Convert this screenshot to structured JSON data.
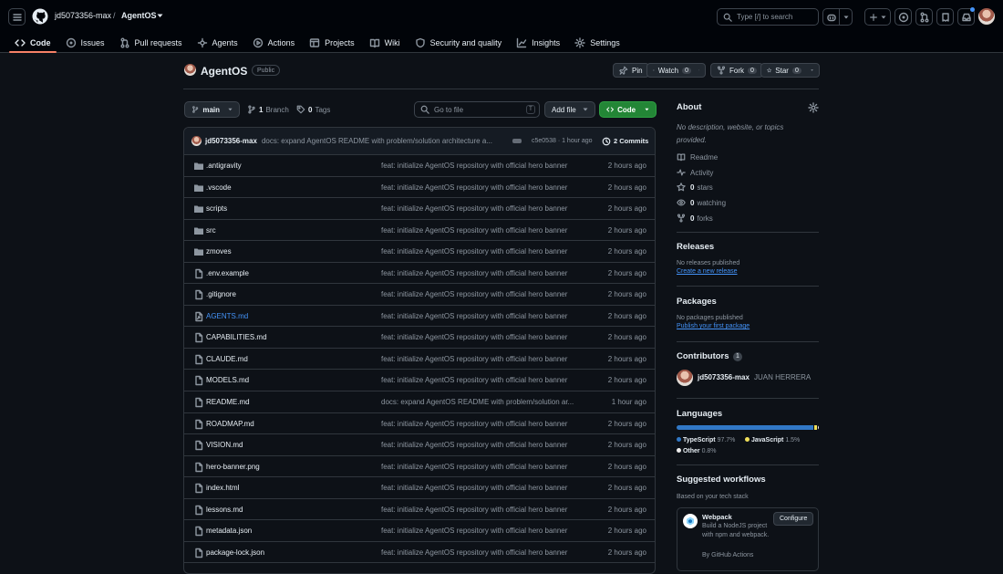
{
  "header": {
    "owner": "jd5073356-max",
    "separator": "/",
    "repo": "AgentOS",
    "search_text": "Type [/] to search"
  },
  "nav": {
    "tabs": [
      {
        "label": "Code",
        "icon": "code-icon",
        "active": true
      },
      {
        "label": "Issues",
        "icon": "issue-icon"
      },
      {
        "label": "Pull requests",
        "icon": "pull-request-icon"
      },
      {
        "label": "Agents",
        "icon": "agents-icon"
      },
      {
        "label": "Actions",
        "icon": "play-icon"
      },
      {
        "label": "Projects",
        "icon": "table-icon"
      },
      {
        "label": "Wiki",
        "icon": "book-icon"
      },
      {
        "label": "Security and quality",
        "icon": "shield-icon"
      },
      {
        "label": "Insights",
        "icon": "graph-icon"
      },
      {
        "label": "Settings",
        "icon": "gear-icon"
      }
    ]
  },
  "repo_header": {
    "title": "AgentOS",
    "visibility": "Public",
    "pin_label": "Pin",
    "watch_label": "Watch",
    "watch_count": "0",
    "fork_label": "Fork",
    "fork_count": "0",
    "star_label": "Star",
    "star_count": "0"
  },
  "toolbar": {
    "branch": "main",
    "branch_count": "1",
    "branch_label": "Branch",
    "tag_count": "0",
    "tag_label": "Tags",
    "goto_placeholder": "Go to file",
    "goto_key": "T",
    "add_file": "Add file",
    "code_label": "Code"
  },
  "latest_commit": {
    "author": "jd5073356-max",
    "message": "docs: expand AgentOS README with problem/solution architecture a...",
    "hash": "c5e0538",
    "time": "· 1 hour ago",
    "commits": "2 Commits"
  },
  "files": [
    {
      "name": ".antigravity",
      "type": "dir",
      "message": "feat: initialize AgentOS repository with official hero banner",
      "time": "2 hours ago"
    },
    {
      "name": ".vscode",
      "type": "dir",
      "message": "feat: initialize AgentOS repository with official hero banner",
      "time": "2 hours ago"
    },
    {
      "name": "scripts",
      "type": "dir",
      "message": "feat: initialize AgentOS repository with official hero banner",
      "time": "2 hours ago"
    },
    {
      "name": "src",
      "type": "dir",
      "message": "feat: initialize AgentOS repository with official hero banner",
      "time": "2 hours ago"
    },
    {
      "name": "zmoves",
      "type": "dir",
      "message": "feat: initialize AgentOS repository with official hero banner",
      "time": "2 hours ago"
    },
    {
      "name": ".env.example",
      "type": "file",
      "message": "feat: initialize AgentOS repository with official hero banner",
      "time": "2 hours ago"
    },
    {
      "name": ".gitignore",
      "type": "file",
      "message": "feat: initialize AgentOS repository with official hero banner",
      "time": "2 hours ago"
    },
    {
      "name": "AGENTS.md",
      "type": "link",
      "message": "feat: initialize AgentOS repository with official hero banner",
      "time": "2 hours ago"
    },
    {
      "name": "CAPABILITIES.md",
      "type": "file",
      "message": "feat: initialize AgentOS repository with official hero banner",
      "time": "2 hours ago"
    },
    {
      "name": "CLAUDE.md",
      "type": "file",
      "message": "feat: initialize AgentOS repository with official hero banner",
      "time": "2 hours ago"
    },
    {
      "name": "MODELS.md",
      "type": "file",
      "message": "feat: initialize AgentOS repository with official hero banner",
      "time": "2 hours ago"
    },
    {
      "name": "README.md",
      "type": "file",
      "message": "docs: expand AgentOS README with problem/solution ar...",
      "time": "1 hour ago"
    },
    {
      "name": "ROADMAP.md",
      "type": "file",
      "message": "feat: initialize AgentOS repository with official hero banner",
      "time": "2 hours ago"
    },
    {
      "name": "VISION.md",
      "type": "file",
      "message": "feat: initialize AgentOS repository with official hero banner",
      "time": "2 hours ago"
    },
    {
      "name": "hero-banner.png",
      "type": "file",
      "message": "feat: initialize AgentOS repository with official hero banner",
      "time": "2 hours ago"
    },
    {
      "name": "index.html",
      "type": "file",
      "message": "feat: initialize AgentOS repository with official hero banner",
      "time": "2 hours ago"
    },
    {
      "name": "lessons.md",
      "type": "file",
      "message": "feat: initialize AgentOS repository with official hero banner",
      "time": "2 hours ago"
    },
    {
      "name": "metadata.json",
      "type": "file",
      "message": "feat: initialize AgentOS repository with official hero banner",
      "time": "2 hours ago"
    },
    {
      "name": "package-lock.json",
      "type": "file",
      "message": "feat: initialize AgentOS repository with official hero banner",
      "time": "2 hours ago"
    }
  ],
  "sidebar": {
    "about_title": "About",
    "about_desc": "No description, website, or topics provided.",
    "readme": "Readme",
    "activity": "Activity",
    "stars_count": "0",
    "stars_label": "stars",
    "watching_count": "0",
    "watching_label": "watching",
    "forks_count": "0",
    "forks_label": "forks",
    "releases_title": "Releases",
    "releases_none": "No releases published",
    "releases_link": "Create a new release",
    "packages_title": "Packages",
    "packages_none": "No packages published",
    "packages_link": "Publish your first package",
    "contributors_title": "Contributors",
    "contributors_count": "1",
    "contributor_login": "jd5073356-max",
    "contributor_name": "JUAN HERRERA",
    "languages_title": "Languages",
    "languages": [
      {
        "name": "TypeScript",
        "percent": "97.7%",
        "value": 97.7,
        "color": "#3178c6"
      },
      {
        "name": "JavaScript",
        "percent": "1.5%",
        "value": 1.5,
        "color": "#f1e05a"
      },
      {
        "name": "Other",
        "percent": "0.8%",
        "value": 0.8,
        "color": "#ededed"
      }
    ],
    "workflows_title": "Suggested workflows",
    "workflows_sub": "Based on your tech stack",
    "workflow_name": "Webpack",
    "workflow_desc": "Build a NodeJS project with npm and webpack.",
    "workflow_by": "By GitHub Actions",
    "workflow_button": "Configure"
  }
}
